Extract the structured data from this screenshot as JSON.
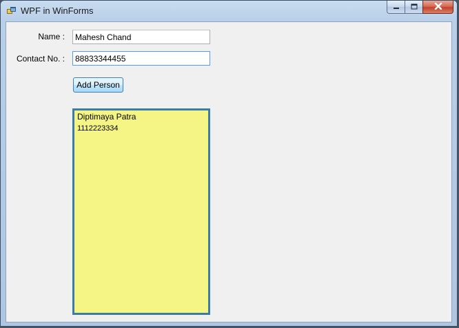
{
  "window": {
    "title": "WPF in WinForms"
  },
  "form": {
    "name_label": "Name :",
    "name_value": "Mahesh Chand",
    "contact_label": "Contact No. :",
    "contact_value": "88833344455",
    "add_button_label": "Add Person"
  },
  "person_card": {
    "name": "Diptimaya Patra",
    "contact": "1112223334",
    "background_color": "#f5f585",
    "border_color": "#3a7ca5"
  },
  "icons": {
    "app": "app-icon",
    "minimize": "minimize-icon",
    "maximize": "maximize-icon",
    "close": "close-icon"
  }
}
